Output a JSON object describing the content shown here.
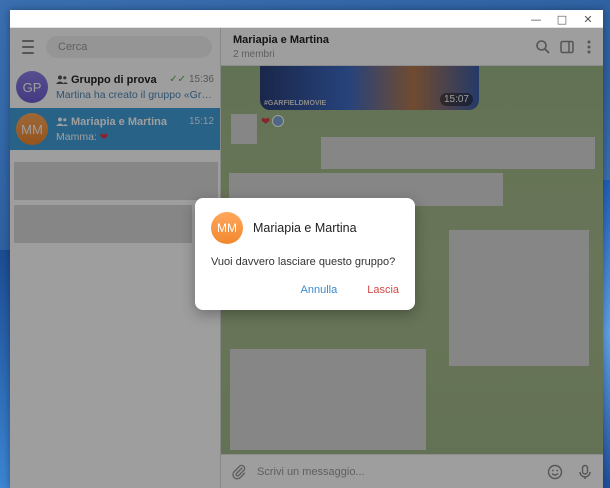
{
  "sidebar": {
    "search_placeholder": "Cerca",
    "chats": [
      {
        "initials": "GP",
        "name": "Gruppo di prova",
        "time": "15:36",
        "preview": "Martina ha creato il gruppo «Gruppo …",
        "read": true
      },
      {
        "initials": "MM",
        "name": "Mariapia e Martina",
        "time": "15:12",
        "preview": "Mamma: "
      }
    ]
  },
  "chat": {
    "title": "Mariapia e Martina",
    "subtitle": "2 membri",
    "video_tag": "#GARFIELDMOVIE",
    "video_duration": "15:07",
    "input_placeholder": "Scrivi un messaggio..."
  },
  "dialog": {
    "initials": "MM",
    "title": "Mariapia e Martina",
    "text": "Vuoi davvero lasciare questo gruppo?",
    "cancel_label": "Annulla",
    "leave_label": "Lascia"
  },
  "colors": {
    "active_chat": "#419fd9",
    "leave_red": "#d24a44",
    "cancel_blue": "#3a8bd0"
  }
}
